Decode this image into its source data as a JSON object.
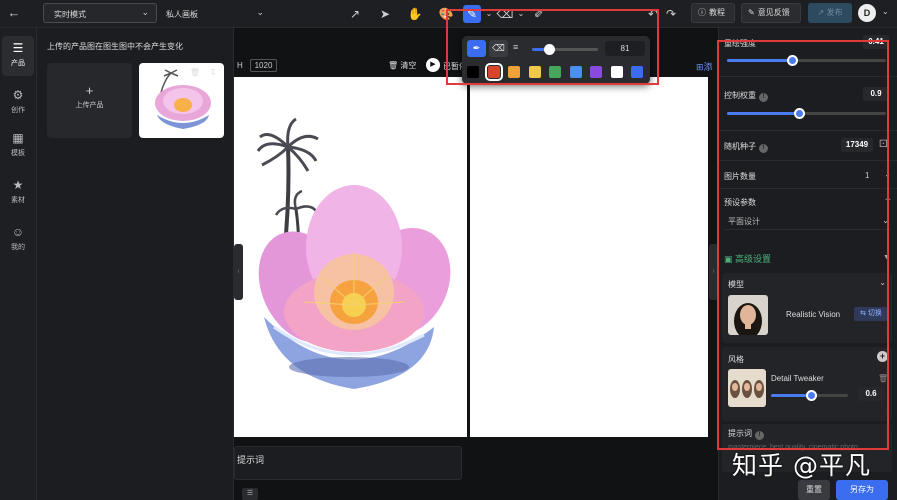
{
  "header": {
    "mode_select": "实时模式",
    "canvas_select": "私人画板",
    "tutorial_label": "教程",
    "feedback_label": "意见反馈",
    "publish_label": "发布",
    "avatar_initial": "D"
  },
  "leftnav": {
    "items": [
      {
        "label": "产品",
        "icon": "sliders-icon"
      },
      {
        "label": "创作",
        "icon": "adjust-icon"
      },
      {
        "label": "模板",
        "icon": "template-icon"
      },
      {
        "label": "素材",
        "icon": "assets-icon"
      },
      {
        "label": "我的",
        "icon": "user-icon"
      }
    ]
  },
  "product_panel": {
    "title": "上传的产品图在图生图中不会产生变化",
    "upload_label": "上传产品"
  },
  "canvas": {
    "h_label": "H",
    "h_value": "1020",
    "clear_label": "清空",
    "paused_label": "已暂停",
    "add_label": "添"
  },
  "brush_popover": {
    "size_value": "81",
    "size_fraction": 0.26,
    "colors": [
      "#000000",
      "#d9442c",
      "#f0a23a",
      "#f0c84a",
      "#4aa55c",
      "#4a8ef0",
      "#8a4ae0",
      "#ffffff",
      "#3a6df0"
    ],
    "selected_color_index": 1
  },
  "prompt_box": {
    "label": "提示词"
  },
  "settings": {
    "redraw_strength_label": "重绘强度",
    "redraw_strength_value": "0.41",
    "redraw_strength_fraction": 0.41,
    "control_weight_label": "控制权重",
    "control_weight_value": "0.9",
    "control_weight_fraction": 0.45,
    "seed_label": "随机种子",
    "seed_value": "17349",
    "image_count_label": "图片数量",
    "image_count_value": "1",
    "preset_label": "预设参数",
    "preset_value": "平面设计",
    "advanced_label": "高级设置",
    "model_label": "模型",
    "model_name": "Realistic Vision",
    "switch_label": "切换",
    "style_label": "风格",
    "style_name": "Detail Tweaker",
    "style_weight": "0.6",
    "style_weight_fraction": 0.52,
    "prompt_label": "提示词",
    "prompt_text": "masterpiece, best quality, cinematic photo"
  },
  "footer": {
    "reset_label": "重置",
    "saveas_label": "另存为"
  },
  "watermark": "知乎 @平凡"
}
